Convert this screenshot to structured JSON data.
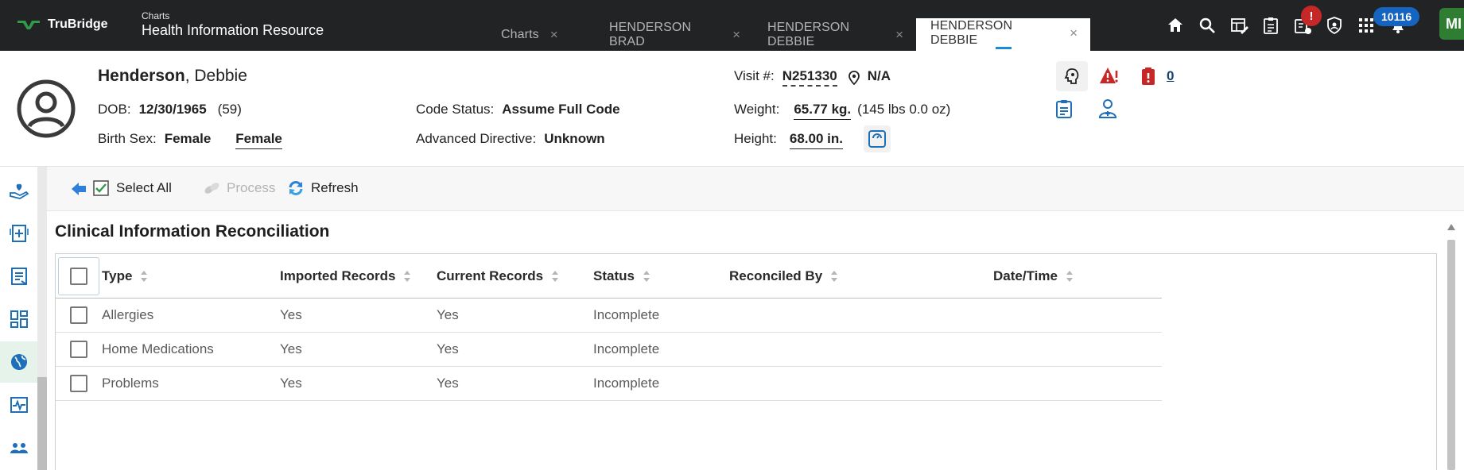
{
  "app": {
    "brand": "TruBridge",
    "subtitle": "Charts",
    "title": "Health Information Resource"
  },
  "tabs": [
    {
      "label": "Charts",
      "active": false
    },
    {
      "label": "HENDERSON BRAD",
      "active": false
    },
    {
      "label": "HENDERSON DEBBIE",
      "active": false
    },
    {
      "label": "HENDERSON DEBBIE",
      "active": true
    }
  ],
  "tab_close_glyph": "×",
  "top_icons": [
    "home-icon",
    "search-icon",
    "edit-table-icon",
    "clipboard-icon",
    "rx-alert-icon",
    "shield-icon",
    "apps-grid-icon",
    "bell-icon"
  ],
  "alert_badge": "!",
  "notification_count": "10116",
  "user_initials": "MI",
  "patient": {
    "last_name": "Henderson",
    "first_name": ", Debbie",
    "dob_label": "DOB:",
    "dob": "12/30/1965",
    "age": "(59)",
    "birth_sex_label": "Birth Sex:",
    "birth_sex": "Female",
    "gender": "Female",
    "code_status_label": "Code Status:",
    "code_status": "Assume Full Code",
    "advanced_directive_label": "Advanced Directive:",
    "advanced_directive": "Unknown",
    "visit_label": "Visit #:",
    "visit_number": "N251330",
    "location": "N/A",
    "weight_label": "Weight:",
    "weight": "65.77 kg.",
    "weight_lbs": "(145 lbs 0.0 oz)",
    "height_label": "Height:",
    "height": "68.00 in.",
    "alert_count": "0"
  },
  "banner_icons": [
    "brain-icon",
    "allergy-alert-icon",
    "isolation-icon",
    "notes-icon",
    "care-team-icon",
    "scale-icon"
  ],
  "rail_icons": [
    "hand-care-icon",
    "add-document-icon",
    "report-icon",
    "dashboard-icon",
    "globe-icon",
    "vitals-icon",
    "people-icon"
  ],
  "toolbar": {
    "select_all": "Select All",
    "process": "Process",
    "refresh": "Refresh"
  },
  "section_title": "Clinical Information Reconciliation",
  "table": {
    "columns": [
      "Type",
      "Imported Records",
      "Current Records",
      "Status",
      "Reconciled By",
      "Date/Time"
    ],
    "rows": [
      [
        "Allergies",
        "Yes",
        "Yes",
        "Incomplete",
        "",
        ""
      ],
      [
        "Home Medications",
        "Yes",
        "Yes",
        "Incomplete",
        "",
        ""
      ],
      [
        "Problems",
        "Yes",
        "Yes",
        "Incomplete",
        "",
        ""
      ]
    ]
  },
  "colors": {
    "topbar": "#212325",
    "brand_green": "#2e9a4a",
    "accent_blue": "#1a8cd8",
    "icon_blue": "#1e6fb8",
    "alert_red": "#c62828"
  }
}
